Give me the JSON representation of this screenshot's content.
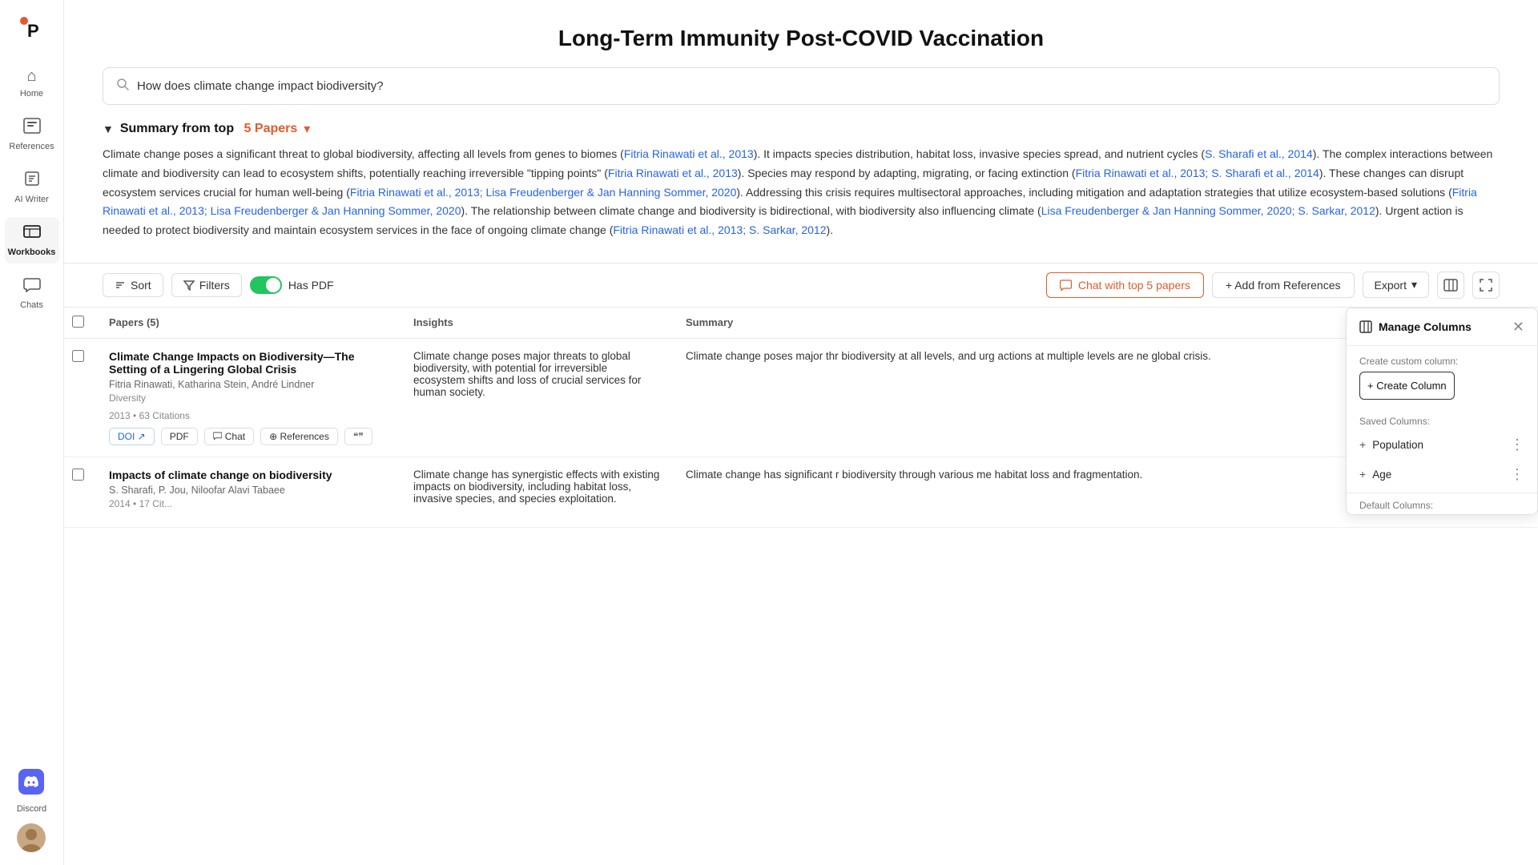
{
  "app": {
    "logo": "P"
  },
  "sidebar": {
    "items": [
      {
        "id": "home",
        "label": "Home",
        "icon": "⌂",
        "active": false
      },
      {
        "id": "references",
        "label": "References",
        "icon": "📁",
        "active": false
      },
      {
        "id": "ai-writer",
        "label": "AI Writer",
        "icon": "✏️",
        "active": false
      },
      {
        "id": "workbooks",
        "label": "Workbooks",
        "icon": "📋",
        "active": true
      },
      {
        "id": "chats",
        "label": "Chats",
        "icon": "💬",
        "active": false
      }
    ],
    "discord_label": "Discord"
  },
  "page": {
    "title": "Long-Term Immunity Post-COVID Vaccination",
    "search_placeholder": "How does climate change impact biodiversity?",
    "search_value": "How does climate change impact biodiversity?"
  },
  "summary": {
    "label": "Summary from top",
    "papers_count": "5 Papers",
    "toggle_icon": "▼",
    "text_parts": [
      {
        "text": "Climate change poses a significant threat to global biodiversity, affecting all levels from genes to biomes (",
        "type": "plain"
      },
      {
        "text": "Fitria Rinawati et al., 2013",
        "type": "link"
      },
      {
        "text": "). It impacts species distribution, habitat loss, invasive species spread, and nutrient cycles (",
        "type": "plain"
      },
      {
        "text": "S. Sharafi et al., 2014",
        "type": "link"
      },
      {
        "text": "). The complex interactions between climate and biodiversity can lead to ecosystem shifts, potentially reaching irreversible \"tipping points\" (",
        "type": "plain"
      },
      {
        "text": "Fitria Rinawati et al., 2013",
        "type": "link"
      },
      {
        "text": "). Species may respond by adapting, migrating, or facing extinction (",
        "type": "plain"
      },
      {
        "text": "Fitria Rinawati et al., 2013; S. Sharafi et al., 2014",
        "type": "link"
      },
      {
        "text": "). These changes can disrupt ecosystem services crucial for human well-being (",
        "type": "plain"
      },
      {
        "text": "Fitria Rinawati et al., 2013; Lisa Freudenberger & Jan Hanning Sommer, 2020",
        "type": "link"
      },
      {
        "text": "). Addressing this crisis requires multisectoral approaches, including mitigation and adaptation strategies that utilize ecosystem-based solutions (",
        "type": "plain"
      },
      {
        "text": "Fitria Rinawati et al., 2013; Lisa Freudenberger & Jan Hanning Sommer, 2020",
        "type": "link"
      },
      {
        "text": "). The relationship between climate change and biodiversity is bidirectional, with biodiversity also influencing climate (",
        "type": "plain"
      },
      {
        "text": "Lisa Freudenberger & Jan Hanning Sommer, 2020; S. Sarkar, 2012",
        "type": "link"
      },
      {
        "text": "). Urgent action is needed to protect biodiversity and maintain ecosystem services in the face of ongoing climate change (",
        "type": "plain"
      },
      {
        "text": "Fitria Rinawati et al., 2013; S. Sarkar, 2012",
        "type": "link"
      },
      {
        "text": ").",
        "type": "plain"
      }
    ]
  },
  "toolbar": {
    "sort_label": "Sort",
    "filters_label": "Filters",
    "has_pdf_label": "Has PDF",
    "chat_btn_label": "Chat with top 5 papers",
    "add_btn_label": "+ Add from References",
    "export_label": "Export"
  },
  "table": {
    "columns": [
      "Papers (5)",
      "Insights",
      "Summary"
    ],
    "rows": [
      {
        "title": "Climate Change Impacts on Biodiversity—The Setting of a Lingering Global Crisis",
        "authors": "Fitria Rinawati, Katharina Stein, André Lindner",
        "journal": "Diversity",
        "year": "2013",
        "citations": "63 Citations",
        "badges": [
          "DOI ↗",
          "PDF",
          "Chat",
          "References",
          "❝❝"
        ],
        "insights": "Climate change poses major threats to global biodiversity, with potential for irreversible ecosystem shifts and loss of crucial services for human society.",
        "summary": "Climate change poses major thr biodiversity at all levels, and urg actions at multiple levels are ne global crisis."
      },
      {
        "title": "Impacts of climate change on biodiversity",
        "authors": "S. Sharafi, P. Jou, Niloofar Alavi Tabaee",
        "journal": "",
        "year": "2014",
        "citations": "17 Cit...",
        "badges": [],
        "insights": "Climate change has synergistic effects with existing impacts on biodiversity, including habitat loss, invasive species, and species exploitation.",
        "summary": "Climate change has significant r biodiversity through various me habitat loss and fragmentation."
      }
    ]
  },
  "manage_columns": {
    "title": "Manage Columns",
    "create_label": "Create custom column:",
    "create_btn": "+ Create Column",
    "saved_label": "Saved Columns:",
    "saved_items": [
      "Population",
      "Age"
    ],
    "default_label": "Default Columns:"
  }
}
